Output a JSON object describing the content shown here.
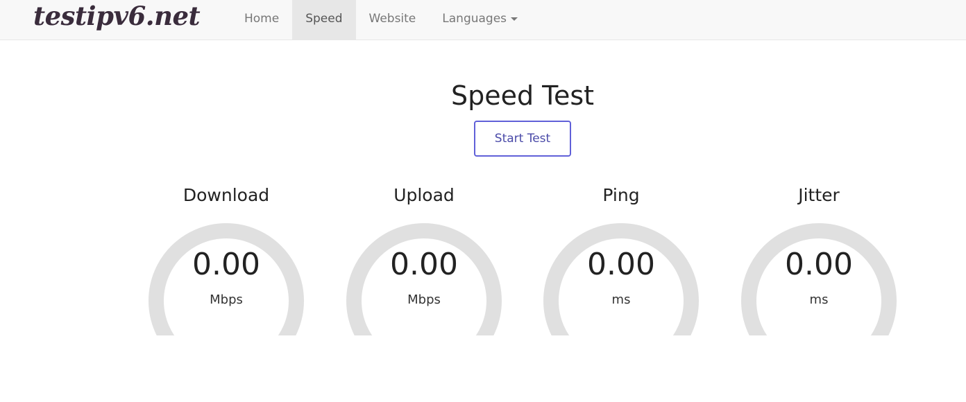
{
  "navbar": {
    "brand": "testipv6.net",
    "items": [
      {
        "label": "Home"
      },
      {
        "label": "Speed"
      },
      {
        "label": "Website"
      },
      {
        "label": "Languages"
      }
    ],
    "active": "Speed"
  },
  "main": {
    "title": "Speed Test",
    "start_button": "Start Test"
  },
  "gauges": [
    {
      "title": "Download",
      "value": "0.00",
      "unit": "Mbps",
      "fill": 0
    },
    {
      "title": "Upload",
      "value": "0.00",
      "unit": "Mbps",
      "fill": 0
    },
    {
      "title": "Ping",
      "value": "0.00",
      "unit": "ms",
      "fill": 0
    },
    {
      "title": "Jitter",
      "value": "0.00",
      "unit": "ms",
      "fill": 0
    }
  ],
  "colors": {
    "gauge_track": "#e0e0e0",
    "button_border": "#6060d8",
    "nav_active_bg": "#e7e7e7"
  }
}
